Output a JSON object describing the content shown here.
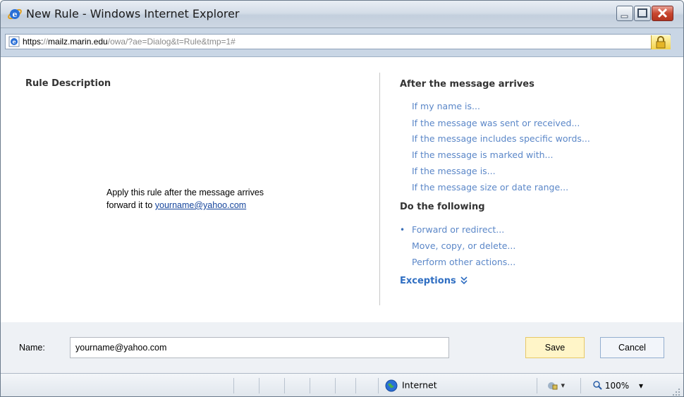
{
  "window": {
    "title": "New Rule - Windows Internet Explorer",
    "controls": [
      "minimize",
      "maximize",
      "close"
    ]
  },
  "address_bar": {
    "scheme": "https:",
    "slashes": "//",
    "host": "mailz.marin.edu",
    "path": "/owa/?ae=Dialog&t=Rule&tmp=1#"
  },
  "left_panel": {
    "title": "Rule Description",
    "line1": "Apply this rule after the message arrives",
    "line2_prefix": "forward it to ",
    "line2_link": "yourname@yahoo.com"
  },
  "right_panel": {
    "after_title": "After the message arrives",
    "conditions": [
      "If my name is...",
      "If the message was sent or received...",
      "If the message includes specific words...",
      "If the message is marked with...",
      "If the message is...",
      "If the message size or date range..."
    ],
    "do_title": "Do the following",
    "actions": [
      "Forward or redirect...",
      "Move, copy, or delete...",
      "Perform other actions..."
    ],
    "exceptions_label": "Exceptions"
  },
  "footer": {
    "name_label": "Name:",
    "name_value": "yourname@yahoo.com",
    "save_label": "Save",
    "cancel_label": "Cancel"
  },
  "status_bar": {
    "zone": "Internet",
    "zoom": "100%"
  },
  "colors": {
    "link": "#5b87c8",
    "accent": "#2f6ec2",
    "save_bg": "#fff5c8"
  }
}
